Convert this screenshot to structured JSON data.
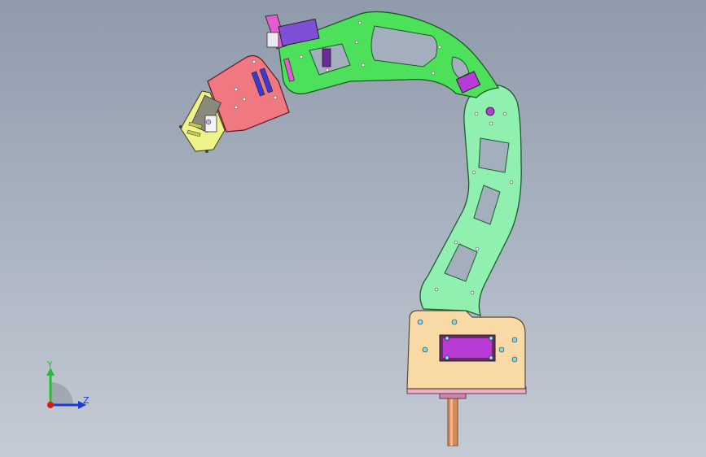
{
  "viewport": {
    "background_top": "#8f9aab",
    "background_bottom": "#c4cbd5"
  },
  "model": {
    "colors": {
      "base": "#f9d9a6",
      "servo": "#b83bd6",
      "lower_arm": "#8ff0b0",
      "upper_arm": "#4de05a",
      "wrist_plate": "#f07880",
      "gripper": "#eef38c",
      "bracket": "#e65bd0",
      "shaft": "#d98a5a",
      "hole": "#7fd9e8"
    }
  },
  "triad": {
    "y_label": "Y",
    "z_label": "Z",
    "y_color": "#22c02a",
    "z_color": "#1a3ad8",
    "origin_color": "#e01818"
  }
}
